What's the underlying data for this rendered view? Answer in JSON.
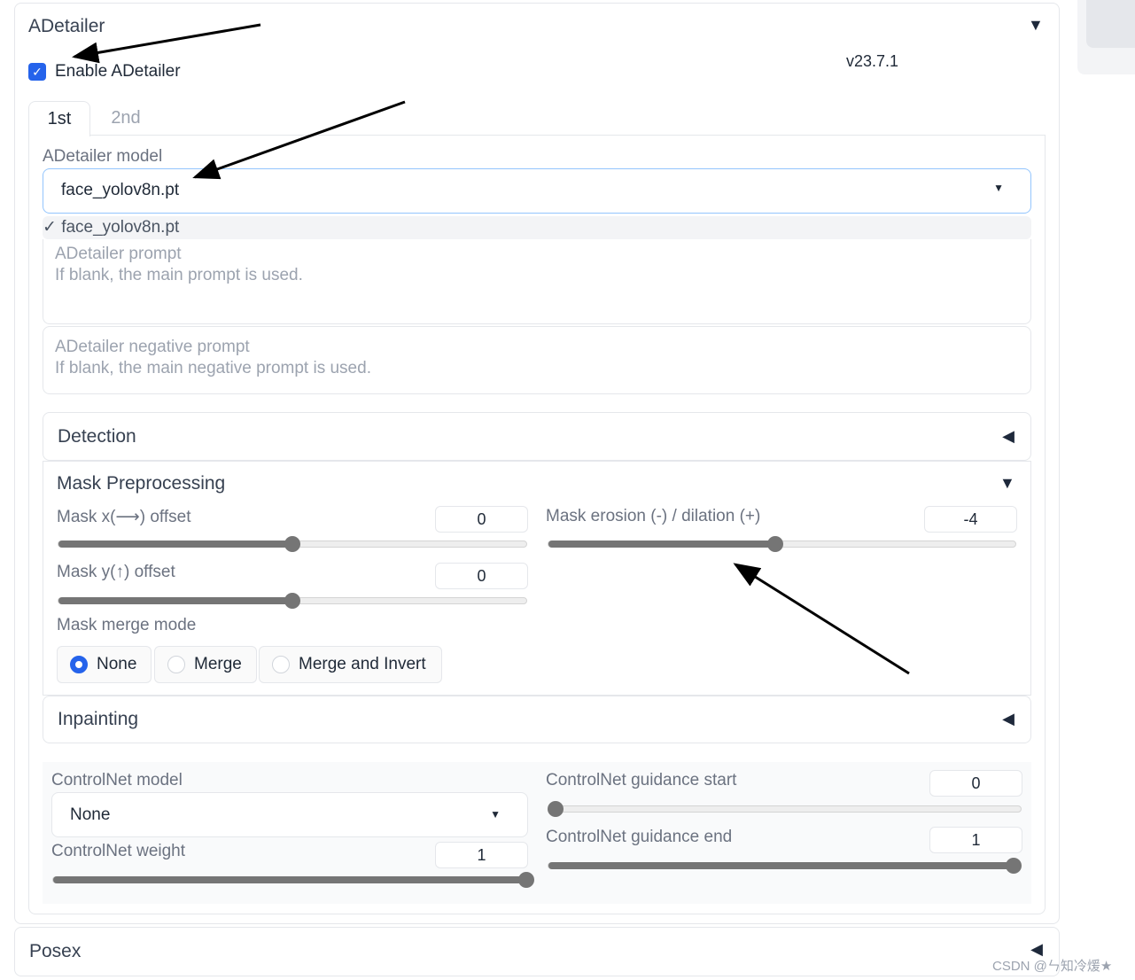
{
  "adetailer": {
    "title": "ADetailer",
    "collapse_icon": "triangle-down",
    "enable_label": "Enable ADetailer",
    "enabled": true,
    "version": "v23.7.1",
    "tabs": [
      {
        "label": "1st",
        "active": true
      },
      {
        "label": "2nd",
        "active": false
      }
    ],
    "model_label": "ADetailer model",
    "model_value": "face_yolov8n.pt",
    "dropdown_option": "✓ face_yolov8n.pt",
    "prompt_placeholder_title": "ADetailer prompt",
    "prompt_placeholder_hint": "If blank, the main prompt is used.",
    "neg_prompt_placeholder_title": "ADetailer negative prompt",
    "neg_prompt_placeholder_hint": "If blank, the main negative prompt is used.",
    "detection": {
      "title": "Detection"
    },
    "mask": {
      "title": "Mask Preprocessing",
      "x_offset": {
        "label": "Mask x(⟶) offset",
        "value": "0",
        "fraction": 0.5
      },
      "y_offset": {
        "label": "Mask y(↑) offset",
        "value": "0",
        "fraction": 0.5
      },
      "erosion": {
        "label": "Mask erosion (-) / dilation (+)",
        "value": "-4",
        "fraction": 0.485
      },
      "merge_label": "Mask merge mode",
      "merge_options": [
        "None",
        "Merge",
        "Merge and Invert"
      ],
      "merge_selected": "None"
    },
    "inpainting": {
      "title": "Inpainting"
    },
    "controlnet": {
      "model_label": "ControlNet model",
      "model_value": "None",
      "weight": {
        "label": "ControlNet weight",
        "value": "1",
        "fraction": 1
      },
      "start": {
        "label": "ControlNet guidance start",
        "value": "0",
        "fraction": 0
      },
      "end": {
        "label": "ControlNet guidance end",
        "value": "1",
        "fraction": 1
      }
    }
  },
  "posex": {
    "title": "Posex"
  },
  "watermark": "CSDN @ㄣ知冷煖★",
  "colors": {
    "accent": "#2563eb",
    "slider": "#757575"
  }
}
